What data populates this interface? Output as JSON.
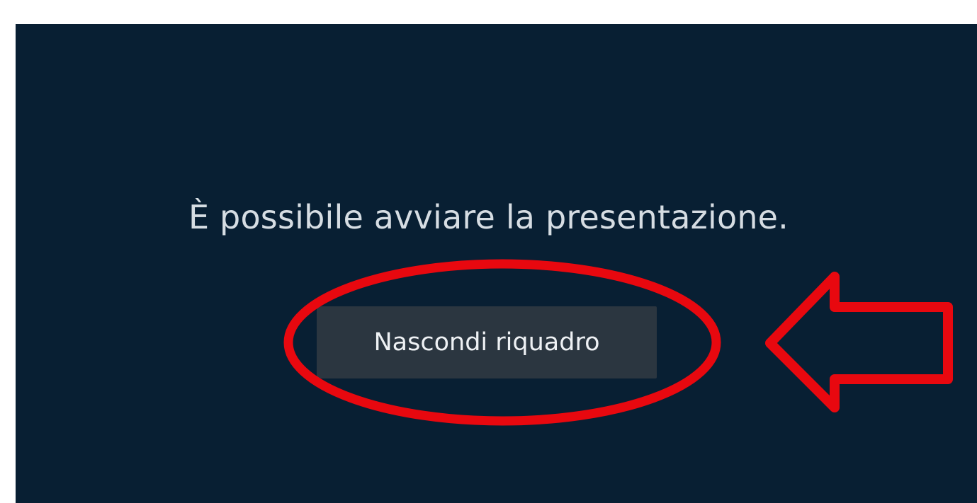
{
  "presentation_pane": {
    "message": "È possibile avviare la presentazione.",
    "hide_button_label": "Nascondi riquadro"
  },
  "annotations": {
    "highlight_ellipse": "red-ellipse",
    "pointer_arrow": "left-arrow-icon",
    "color": "#e8080f"
  },
  "colors": {
    "panel_background": "#081f33",
    "button_background": "#2b3640",
    "text": "#d6dde3"
  }
}
